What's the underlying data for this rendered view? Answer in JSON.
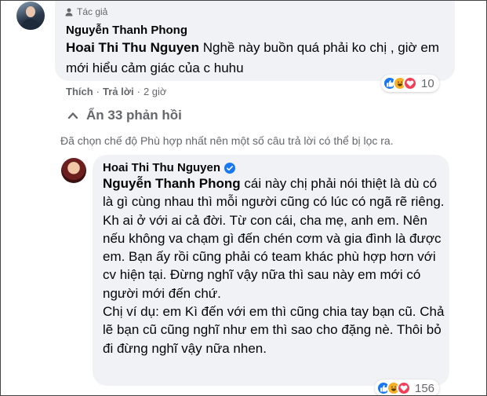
{
  "comment1": {
    "badge": "Tác giả",
    "author": "Nguyễn Thanh Phong",
    "mention": "Hoai Thi Thu Nguyen",
    "text": " Nghề này buồn quá phải ko chị , giờ em mới hiểu cảm giác của c huhu",
    "reaction_count": "10",
    "reactions": [
      "like-icon",
      "haha-icon",
      "love-icon"
    ],
    "actions": {
      "like": "Thích",
      "reply": "Trả lời",
      "time": "2 giờ"
    }
  },
  "hide_replies": "Ẩn 33 phản hồi",
  "filter_note": "Đã chọn chế độ Phù hợp nhất nên một số câu trả lời có thể bị lọc ra.",
  "comment2": {
    "author": "Hoai Thi Thu Nguyen",
    "mention": "Nguyễn Thanh Phong",
    "text_part1": " cái này chị phải nói thiệt là dù có là gì cùng nhau thì mỗi người cũng có lúc có ngã rẽ riêng. Kh ai ở với ai cả đời. Từ con cái, cha mẹ, anh em. Nên nếu không va chạm gì đến chén cơm và gia đình là được em. Bạn ấy rồi cũng phải có team khác phù hợp hơn với cv hiện tại. Đừng nghĩ vậy nữa thì sau này em mới có người mới đến chứ.",
    "text_part2": "Chị ví dụ: em Kì đến với em thì cũng chia tay bạn cũ. Chả lẽ bạn cũ cũng nghĩ như em thì sao cho đặng nè. Thôi bỏ đi đừng nghĩ vậy nữa nhen.",
    "reaction_count": "156",
    "reactions": [
      "like-icon",
      "haha-icon",
      "love-icon"
    ]
  },
  "colors": {
    "bubble": "#f0f2f5",
    "secondary_text": "#65676b",
    "like": "#1877f2",
    "haha": "#f7b125",
    "love": "#f33e58"
  }
}
